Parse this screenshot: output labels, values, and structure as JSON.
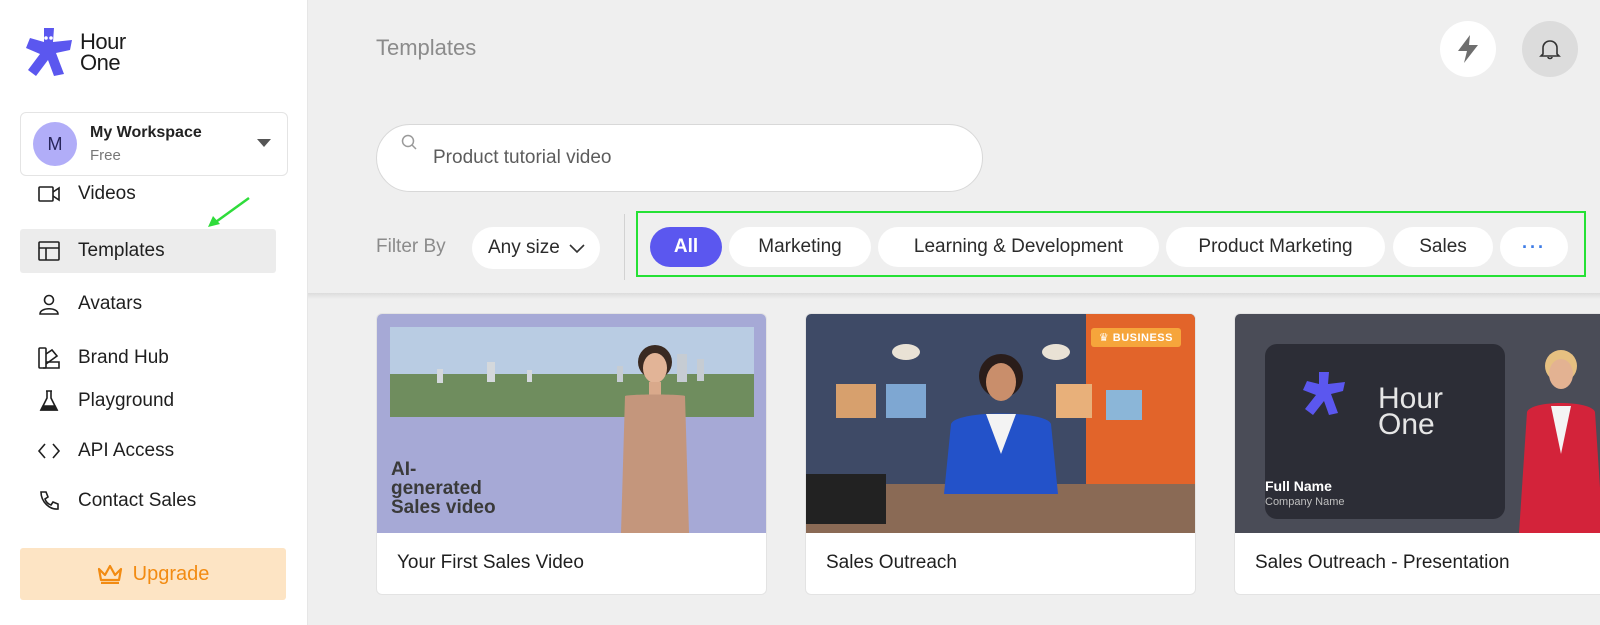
{
  "brand": {
    "logo_line1": "Hour",
    "logo_line2": "One"
  },
  "workspace": {
    "initial": "M",
    "name": "My Workspace",
    "plan": "Free"
  },
  "nav": {
    "items": [
      {
        "label": "Videos"
      },
      {
        "label": "Templates"
      },
      {
        "label": "Avatars"
      },
      {
        "label": "Brand Hub"
      },
      {
        "label": "Playground"
      },
      {
        "label": "API Access"
      },
      {
        "label": "Contact Sales"
      }
    ],
    "active": "Templates"
  },
  "upgrade": {
    "label": "Upgrade"
  },
  "header": {
    "title": "Templates"
  },
  "search": {
    "value": "Product tutorial video"
  },
  "filter": {
    "label": "Filter By",
    "size_value": "Any size",
    "chips": [
      {
        "label": "All"
      },
      {
        "label": "Marketing"
      },
      {
        "label": "Learning & Development"
      },
      {
        "label": "Product Marketing"
      },
      {
        "label": "Sales"
      },
      {
        "label": "···"
      }
    ]
  },
  "cards": [
    {
      "title": "Your First Sales Video",
      "thumb_text": [
        "AI-",
        "generated",
        "Sales video"
      ]
    },
    {
      "title": "Sales Outreach",
      "badge": "BUSINESS"
    },
    {
      "title": "Sales Outreach - Presentation",
      "thumb_logo": [
        "Hour",
        "One"
      ],
      "thumb_name": "Full Name",
      "thumb_company": "Company Name"
    }
  ],
  "colors": {
    "accent": "#5b57ef",
    "highlight": "#25e135",
    "upgrade": "#f28b12"
  }
}
